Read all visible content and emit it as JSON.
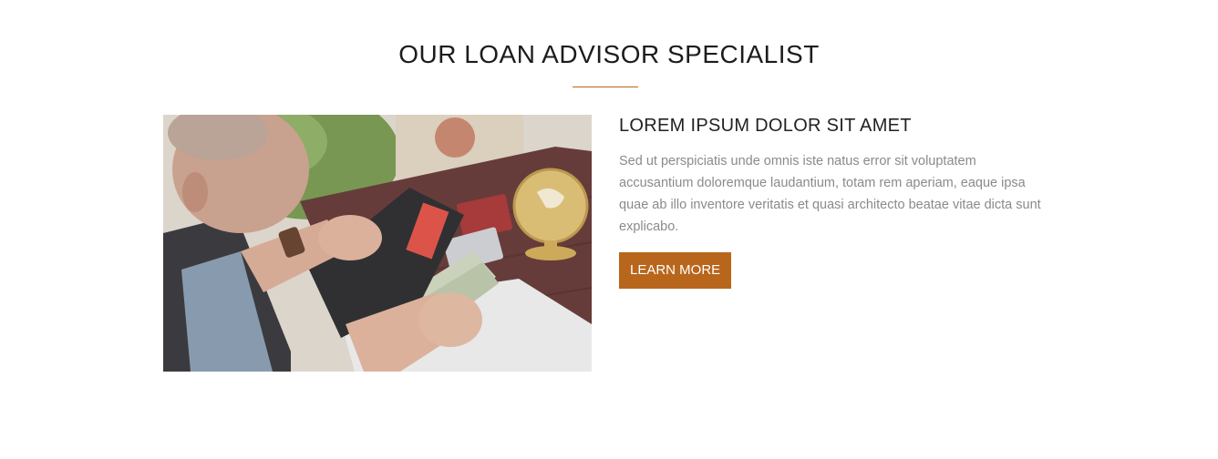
{
  "section": {
    "title": "OUR LOAN ADVISOR SPECIALIST"
  },
  "feature": {
    "heading": "LOREM IPSUM DOLOR SIT AMET",
    "text": "Sed ut perspiciatis unde omnis iste natus error sit voluptatem accusantium doloremque laudantium, totam rem aperiam, eaque ipsa quae ab illo inventore veritatis et quasi architecto beatae vitae dicta sunt explicabo.",
    "button_label": "LEARN MORE"
  },
  "colors": {
    "accent": "#b8661c",
    "heading": "#1c1c1c",
    "body_text": "#8a8a8a"
  }
}
